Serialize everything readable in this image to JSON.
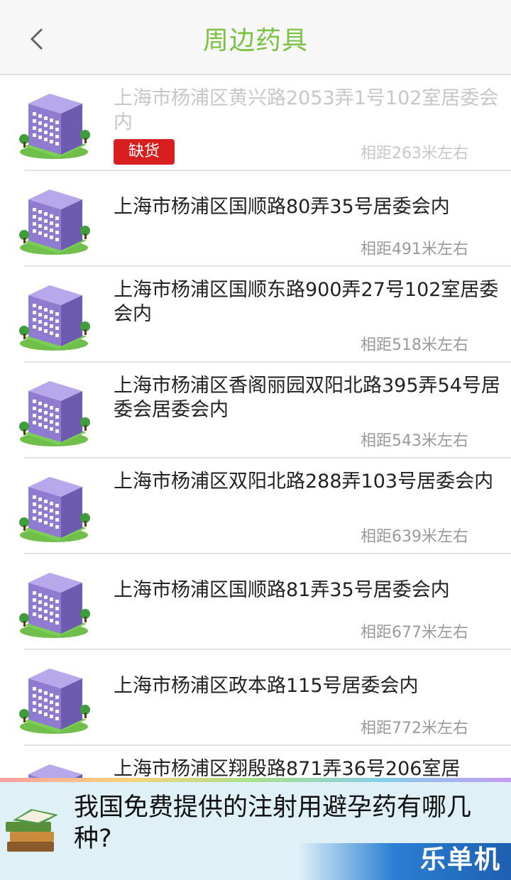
{
  "header": {
    "title": "周边药具"
  },
  "items": [
    {
      "address": "上海市杨浦区黄兴路2053弄1号102室居委会内",
      "distance": "相距263米左右",
      "badge": "缺货"
    },
    {
      "address": "上海市杨浦区国顺路80弄35号居委会内",
      "distance": "相距491米左右"
    },
    {
      "address": "上海市杨浦区国顺东路900弄27号102室居委会内",
      "distance": "相距518米左右"
    },
    {
      "address": "上海市杨浦区香阁丽园双阳北路395弄54号居委会居委会内",
      "distance": "相距543米左右"
    },
    {
      "address": "上海市杨浦区双阳北路288弄103号居委会内",
      "distance": "相距639米左右"
    },
    {
      "address": "上海市杨浦区国顺路81弄35号居委会内",
      "distance": "相距677米左右"
    },
    {
      "address": "上海市杨浦区政本路115号居委会内",
      "distance": "相距772米左右"
    },
    {
      "address": "上海市杨浦区翔殷路871弄36号206室居"
    }
  ],
  "ad": {
    "text": "我国免费提供的注射用避孕药有哪几种?",
    "brand": "乐单机"
  },
  "colors": {
    "title": "#7cc242",
    "badge": "#d81e1e",
    "building": "#8a76c8"
  }
}
